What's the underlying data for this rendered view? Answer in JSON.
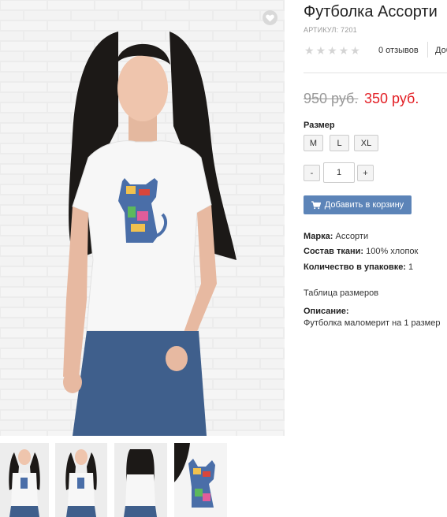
{
  "product": {
    "title": "Футболка Ассорти",
    "sku": "АРТИКУЛ: 7201",
    "reviews_link": "0 отзывов",
    "add_review_link": "Доб",
    "old_price": "950 руб.",
    "new_price": "350 руб.",
    "rating": 0
  },
  "size": {
    "label": "Размер",
    "options": [
      "M",
      "L",
      "XL"
    ]
  },
  "quantity": {
    "minus": "-",
    "value": "1",
    "plus": "+"
  },
  "cart": {
    "button_label": "Добавить в корзину",
    "icon": "cart-icon"
  },
  "specs": {
    "brand_label": "Марка:",
    "brand_value": " Ассорти",
    "fabric_label": "Состав ткани:",
    "fabric_value": " 100% хлопок",
    "pack_label": "Количество в упаковке:",
    "pack_value": " 1"
  },
  "size_table_link": "Таблица размеров",
  "description": {
    "label": "Описание:",
    "text": "Футболка маломерит на 1 размер"
  },
  "colors": {
    "accent_price": "#e31e24",
    "cart_button": "#5c84b8",
    "old_price": "#999999"
  },
  "icons": {
    "wishlist": "heart-icon",
    "star": "star-icon"
  }
}
